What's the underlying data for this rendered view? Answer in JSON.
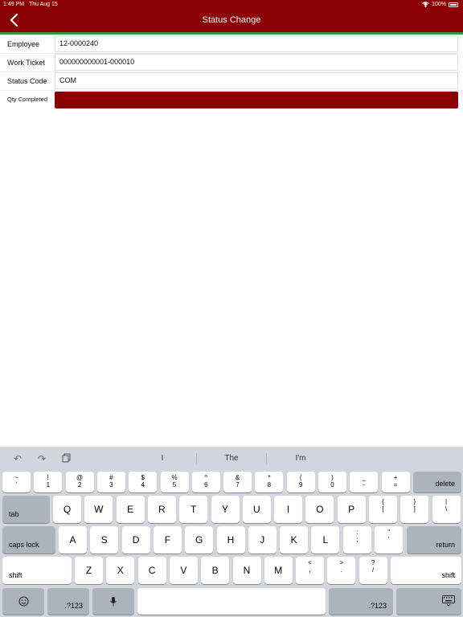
{
  "status_bar": {
    "time": "1:49 PM",
    "date": "Thu Aug 15",
    "battery": "100%"
  },
  "header": {
    "title": "Status Change"
  },
  "form": {
    "employee": {
      "label": "Employee",
      "value": "12-0000240"
    },
    "work_ticket": {
      "label": "Work Ticket",
      "value": "000000000001-000010"
    },
    "status_code": {
      "label": "Status Code",
      "value": "COM"
    },
    "qty_completed": {
      "label": "Qty Completed",
      "value": ""
    }
  },
  "keyboard": {
    "suggestions": [
      "I",
      "The",
      "I'm"
    ],
    "number_row": [
      {
        "top": "~",
        "bot": "`"
      },
      {
        "top": "!",
        "bot": "1"
      },
      {
        "top": "@",
        "bot": "2"
      },
      {
        "top": "#",
        "bot": "3"
      },
      {
        "top": "$",
        "bot": "4"
      },
      {
        "top": "%",
        "bot": "5"
      },
      {
        "top": "^",
        "bot": "6"
      },
      {
        "top": "&",
        "bot": "7"
      },
      {
        "top": "*",
        "bot": "8"
      },
      {
        "top": "(",
        "bot": "9"
      },
      {
        "top": ")",
        "bot": "0"
      },
      {
        "top": "_",
        "bot": "-"
      },
      {
        "top": "+",
        "bot": "="
      }
    ],
    "delete_label": "delete",
    "tab_label": "tab",
    "row_q": [
      "Q",
      "W",
      "E",
      "R",
      "T",
      "Y",
      "U",
      "I",
      "O",
      "P"
    ],
    "row_q_extra": [
      {
        "top": "{",
        "bot": "["
      },
      {
        "top": "}",
        "bot": "]"
      },
      {
        "top": "|",
        "bot": "\\"
      }
    ],
    "caps_label": "caps lock",
    "row_a": [
      "A",
      "S",
      "D",
      "F",
      "G",
      "H",
      "J",
      "K",
      "L"
    ],
    "row_a_extra": [
      {
        "top": ":",
        "bot": ";"
      },
      {
        "top": "\"",
        "bot": "'"
      }
    ],
    "return_label": "return",
    "shift_label": "shift",
    "row_z": [
      "Z",
      "X",
      "C",
      "V",
      "B",
      "N",
      "M"
    ],
    "row_z_extra": [
      {
        "top": "<",
        "bot": ","
      },
      {
        "top": ">",
        "bot": "."
      },
      {
        "top": "?",
        "bot": "/"
      }
    ],
    "numbers_label": ".?123",
    "emoji_icon": "emoji-icon",
    "mic_icon": "microphone-icon",
    "hide_icon": "keyboard-hide-icon"
  },
  "colors": {
    "header": "#8b0000",
    "accent_line": "#2e9a3a",
    "active_field": "#8b0000"
  }
}
